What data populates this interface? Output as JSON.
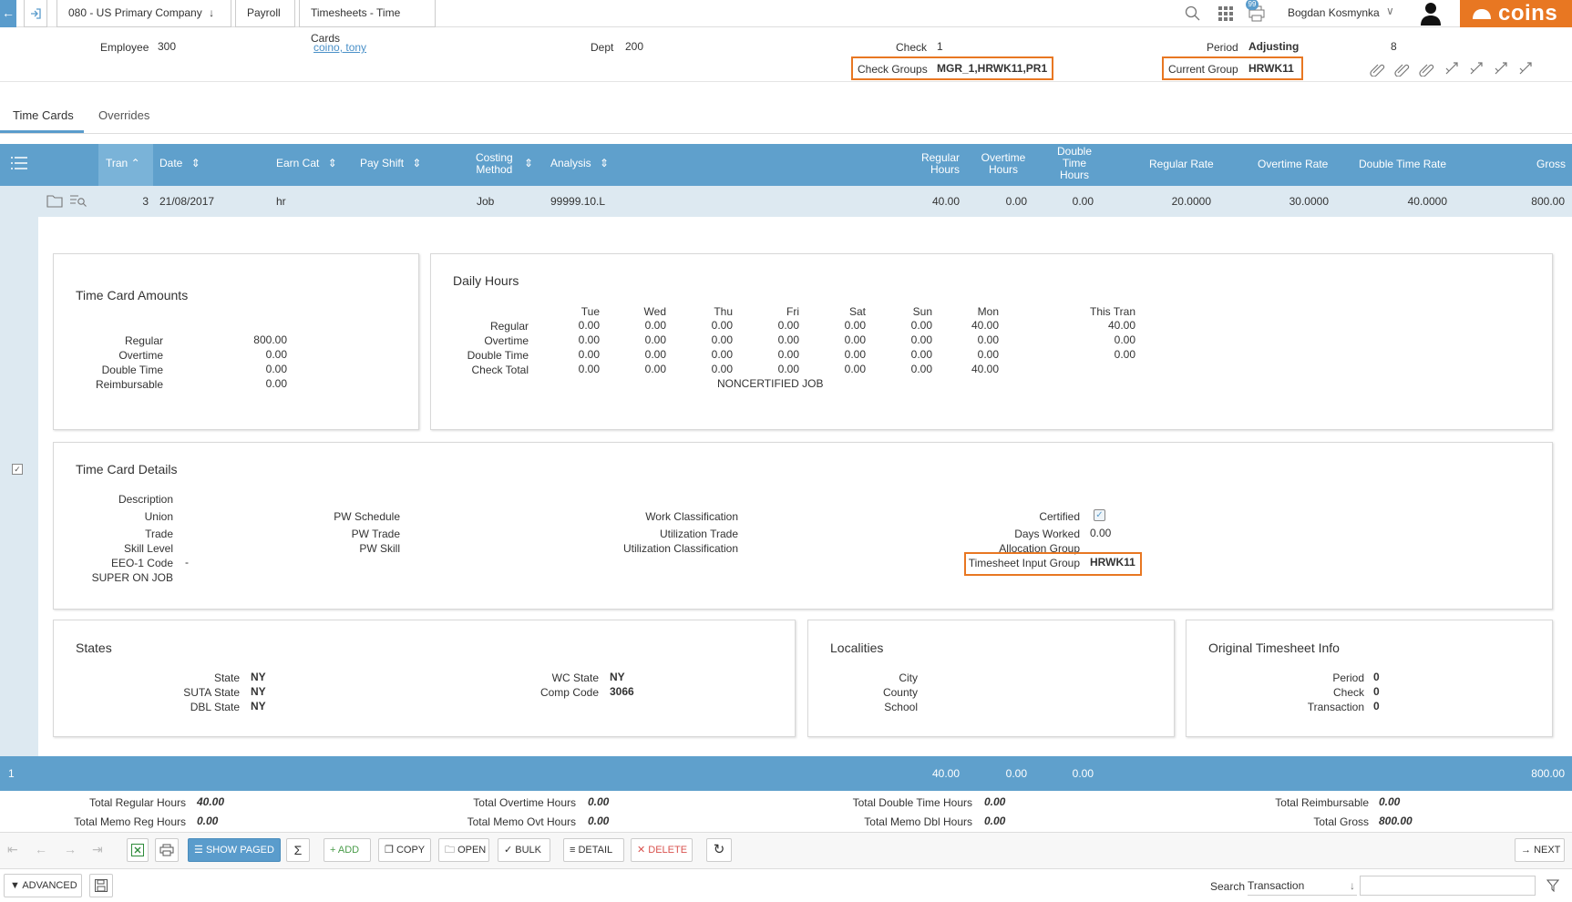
{
  "breadcrumb": {
    "company": "080 - US Primary Company",
    "module": "Payroll",
    "page": "Timesheets - Time Cards"
  },
  "header": {
    "user": "Bogdan Kosmynka",
    "notifications": "99",
    "brand": "coins",
    "brand_color": "#e87722"
  },
  "record": {
    "employee_label": "Employee",
    "employee": "300",
    "employee_name": "coino, tony",
    "dept_label": "Dept",
    "dept": "200",
    "check_label": "Check",
    "check": "1",
    "check_groups_label": "Check Groups",
    "check_groups": "MGR_1,HRWK11,PR1",
    "period_label": "Period",
    "period": "Adjusting",
    "period_num": "8",
    "current_group_label": "Current Group",
    "current_group": "HRWK11"
  },
  "tabs": [
    "Time Cards",
    "Overrides"
  ],
  "grid": {
    "columns": {
      "tran": "Tran",
      "date": "Date",
      "earn_cat": "Earn Cat",
      "pay_shift": "Pay Shift",
      "costing_l1": "Costing",
      "costing_l2": "Method",
      "analysis": "Analysis",
      "reg_l1": "Regular",
      "reg_l2": "Hours",
      "ot_l1": "Overtime",
      "ot_l2": "Hours",
      "dt_l1": "Double",
      "dt_l2": "Time",
      "dt_l3": "Hours",
      "reg_rate": "Regular Rate",
      "ot_rate": "Overtime Rate",
      "dt_rate": "Double Time Rate",
      "gross": "Gross"
    },
    "row": {
      "tran": "3",
      "date": "21/08/2017",
      "earn_cat": "hr",
      "costing": "Job",
      "analysis": "99999.10.L",
      "reg_hours": "40.00",
      "ot_hours": "0.00",
      "dt_hours": "0.00",
      "reg_rate": "20.0000",
      "ot_rate": "30.0000",
      "dt_rate": "40.0000",
      "gross": "800.00"
    },
    "footer": {
      "count": "1",
      "reg": "40.00",
      "ot": "0.00",
      "dt": "0.00",
      "gross": "800.00"
    }
  },
  "amounts": {
    "title": "Time Card Amounts",
    "rows": [
      {
        "label": "Regular",
        "value": "800.00"
      },
      {
        "label": "Overtime",
        "value": "0.00"
      },
      {
        "label": "Double Time",
        "value": "0.00"
      },
      {
        "label": "Reimbursable",
        "value": "0.00"
      }
    ]
  },
  "daily": {
    "title": "Daily Hours",
    "days": [
      "Tue",
      "Wed",
      "Thu",
      "Fri",
      "Sat",
      "Sun",
      "Mon"
    ],
    "this_tran": "This Tran",
    "rows": [
      {
        "label": "Regular",
        "values": [
          "0.00",
          "0.00",
          "0.00",
          "0.00",
          "0.00",
          "0.00",
          "40.00"
        ],
        "tran": "40.00"
      },
      {
        "label": "Overtime",
        "values": [
          "0.00",
          "0.00",
          "0.00",
          "0.00",
          "0.00",
          "0.00",
          "0.00"
        ],
        "tran": "0.00"
      },
      {
        "label": "Double Time",
        "values": [
          "0.00",
          "0.00",
          "0.00",
          "0.00",
          "0.00",
          "0.00",
          "0.00"
        ],
        "tran": "0.00"
      },
      {
        "label": "Check Total",
        "values": [
          "0.00",
          "0.00",
          "0.00",
          "0.00",
          "0.00",
          "0.00",
          "40.00"
        ],
        "tran": ""
      }
    ],
    "note": "NONCERTIFIED JOB"
  },
  "details": {
    "title": "Time Card Details",
    "description": "Description",
    "union": "Union",
    "trade": "Trade",
    "skill_level": "Skill Level",
    "eeo1": "EEO-1 Code",
    "eeo1_value": "-",
    "super": "SUPER ON JOB",
    "pw_schedule": "PW Schedule",
    "pw_trade": "PW Trade",
    "pw_skill": "PW Skill",
    "work_class": "Work Classification",
    "util_trade": "Utilization Trade",
    "util_class": "Utilization Classification",
    "certified": "Certified",
    "days_worked": "Days Worked",
    "days_worked_value": "0.00",
    "allocation": "Allocation Group",
    "input_group_label": "Timesheet Input Group",
    "input_group": "HRWK11"
  },
  "states": {
    "title": "States",
    "state_label": "State",
    "state": "NY",
    "suta_label": "SUTA State",
    "suta": "NY",
    "dbl_label": "DBL State",
    "dbl": "NY",
    "wc_label": "WC State",
    "wc": "NY",
    "comp_label": "Comp Code",
    "comp": "3066"
  },
  "localities": {
    "title": "Localities",
    "city": "City",
    "county": "County",
    "school": "School"
  },
  "original": {
    "title": "Original Timesheet Info",
    "period_label": "Period",
    "period": "0",
    "check_label": "Check",
    "check": "0",
    "tran_label": "Transaction",
    "tran": "0"
  },
  "totals": {
    "reg_label": "Total Regular Hours",
    "reg": "40.00",
    "memo_reg_label": "Total Memo Reg Hours",
    "memo_reg": "0.00",
    "ot_label": "Total Overtime Hours",
    "ot": "0.00",
    "memo_ot_label": "Total Memo Ovt Hours",
    "memo_ot": "0.00",
    "dt_label": "Total Double Time Hours",
    "dt": "0.00",
    "memo_dt_label": "Total Memo Dbl Hours",
    "memo_dt": "0.00",
    "reimb_label": "Total Reimbursable",
    "reimb": "0.00",
    "gross_label": "Total Gross",
    "gross": "800.00"
  },
  "toolbar": {
    "show_paged": "SHOW PAGED",
    "add": "ADD",
    "copy": "COPY",
    "open": "OPEN",
    "bulk": "BULK",
    "detail": "DETAIL",
    "delete": "DELETE",
    "next": "NEXT"
  },
  "bottom": {
    "advanced": "ADVANCED",
    "search_label": "Search",
    "search_field": "Transaction",
    "search_value": ""
  },
  "colors": {
    "grid_header": "#5fa0cc",
    "selected_row": "#dde9f1",
    "accent": "#e87722",
    "blue_button": "#5a9ccc"
  }
}
